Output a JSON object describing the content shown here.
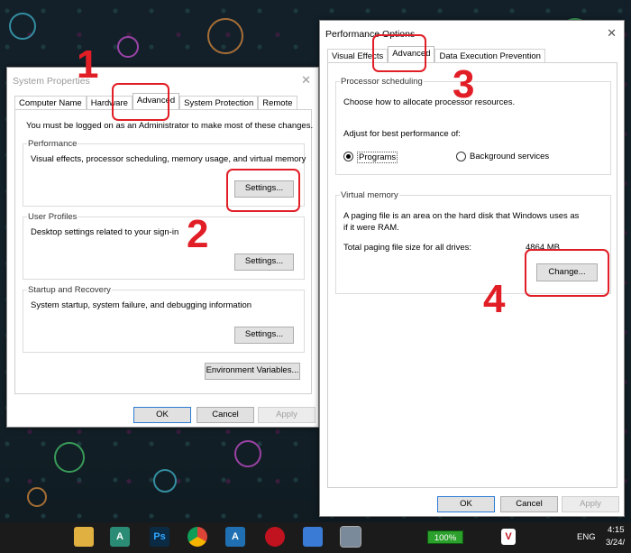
{
  "system_properties": {
    "title": "System Properties",
    "close": "✕",
    "tabs": [
      "Computer Name",
      "Hardware",
      "Advanced",
      "System Protection",
      "Remote"
    ],
    "admin_note": "You must be logged on as an Administrator to make most of these changes.",
    "performance": {
      "label": "Performance",
      "desc": "Visual effects, processor scheduling, memory usage, and virtual memory",
      "button": "Settings..."
    },
    "user_profiles": {
      "label": "User Profiles",
      "desc": "Desktop settings related to your sign-in",
      "button": "Settings..."
    },
    "startup_recovery": {
      "label": "Startup and Recovery",
      "desc": "System startup, system failure, and debugging information",
      "button": "Settings..."
    },
    "env_button": "Environment Variables...",
    "ok": "OK",
    "cancel": "Cancel",
    "apply": "Apply"
  },
  "performance_options": {
    "title": "Performance Options",
    "close": "✕",
    "tabs": [
      "Visual Effects",
      "Advanced",
      "Data Execution Prevention"
    ],
    "processor": {
      "label": "Processor scheduling",
      "desc": "Choose how to allocate processor resources.",
      "adjust": "Adjust for best performance of:",
      "option_programs": "Programs",
      "option_background": "Background services"
    },
    "virtual_memory": {
      "label": "Virtual memory",
      "desc_line1": "A paging file is an area on the hard disk that Windows uses as",
      "desc_line2": "if it were RAM.",
      "total_label": "Total paging file size for all drives:",
      "total_value": "4864 MB",
      "change_button": "Change..."
    },
    "ok": "OK",
    "cancel": "Cancel",
    "apply": "Apply"
  },
  "steps": [
    "1",
    "2",
    "3",
    "4"
  ],
  "taskbar": {
    "icons": [
      "A",
      "Ps",
      "A",
      "V"
    ],
    "battery": "100%",
    "language": "ENG",
    "time": "4:15",
    "date": "3/24/"
  },
  "colors": {
    "callout": "#e11e26",
    "battery": "#2ca02c"
  }
}
